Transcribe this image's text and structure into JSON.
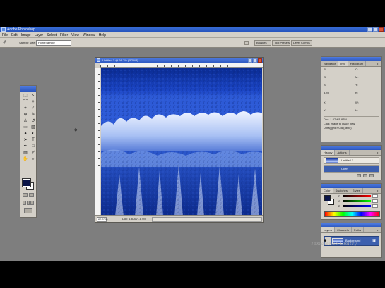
{
  "app": {
    "title": "Adobe Photoshop"
  },
  "menu": [
    "File",
    "Edit",
    "Image",
    "Layer",
    "Select",
    "Filter",
    "View",
    "Window",
    "Help"
  ],
  "options_bar": {
    "tool_icon": "eyedropper-icon",
    "sample_label": "Sample Size:",
    "sample_value": "Point Sample"
  },
  "palette_well": [
    "Brushes",
    "Tool Presets",
    "Layer Comps"
  ],
  "document": {
    "title": "Untitled-1 @ 66.7% (RGB/8)",
    "zoom": "66.67%",
    "doc_size": "Doc: 1.87M/1.87M"
  },
  "navigator_palette": {
    "tabs": [
      "Navigator",
      "Info",
      "Histogram"
    ],
    "active_tab": "Info",
    "rows": [
      {
        "a": "R:",
        "b": "C:"
      },
      {
        "a": "G:",
        "b": "M:"
      },
      {
        "a": "B:",
        "b": "Y:"
      },
      {
        "a": "8-bit",
        "b": "K:"
      },
      {
        "a": "X:",
        "b": "W:"
      },
      {
        "a": "Y:",
        "b": "H:"
      }
    ],
    "info_lines": [
      "Doc: 1.87M/1.87M",
      "Click image to place new",
      "Untagged RGB (8bpc)"
    ]
  },
  "history_palette": {
    "tabs": [
      "History",
      "Actions"
    ],
    "items": [
      "Untitled-1",
      "Open"
    ]
  },
  "color_palette": {
    "tabs": [
      "Color",
      "Swatches",
      "Styles"
    ],
    "channels": [
      "R",
      "G",
      "B"
    ]
  },
  "layers_palette": {
    "tabs": [
      "Layers",
      "Channels",
      "Paths"
    ],
    "layer_name": "Background"
  },
  "colors": {
    "workspace": "#7e7e7e",
    "title_blue": "#2a55bd",
    "panel": "#d4d0c8",
    "foreground": "#0a1448",
    "background": "#ffffff"
  },
  "watermark": "Tomasenko Dmitry"
}
